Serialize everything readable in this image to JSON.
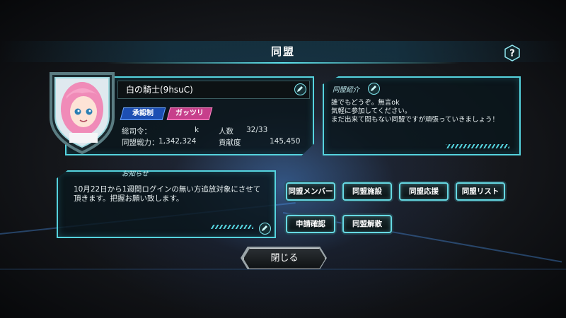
{
  "header": {
    "title": "同盟",
    "help_icon": "question-icon"
  },
  "profile": {
    "name": "白の騎士(9hsuC)",
    "join_mode": "承認制",
    "play_style": "ガッツリ",
    "leader_label": "総司令：",
    "leader_value": "k",
    "members_label": "人数",
    "members_value": "32/33",
    "power_label": "同盟戦力：",
    "power_value": "1,342,324",
    "contribution_label": "貢献度",
    "contribution_value": "145,450"
  },
  "intro": {
    "label": "同盟紹介",
    "text": "誰でもどうぞ。無言ok\n気軽に参加してください。\nまだ出来て間もない同盟ですが頑張っていきましょう！"
  },
  "notice": {
    "label": "お知らせ",
    "text": "10月22日から1週間ログインの無い方追放対象にさせて頂きます。把握お願い致します。"
  },
  "menu": {
    "members": "同盟メンバー",
    "facilities": "同盟施設",
    "support": "同盟応援",
    "list": "同盟リスト",
    "applications": "申請確認",
    "disband": "同盟解散"
  },
  "footer": {
    "close_label": "閉じる"
  },
  "colors": {
    "accent": "#55d3de",
    "tag_blue": "#1d4fb3",
    "tag_pink": "#c73f8b"
  }
}
